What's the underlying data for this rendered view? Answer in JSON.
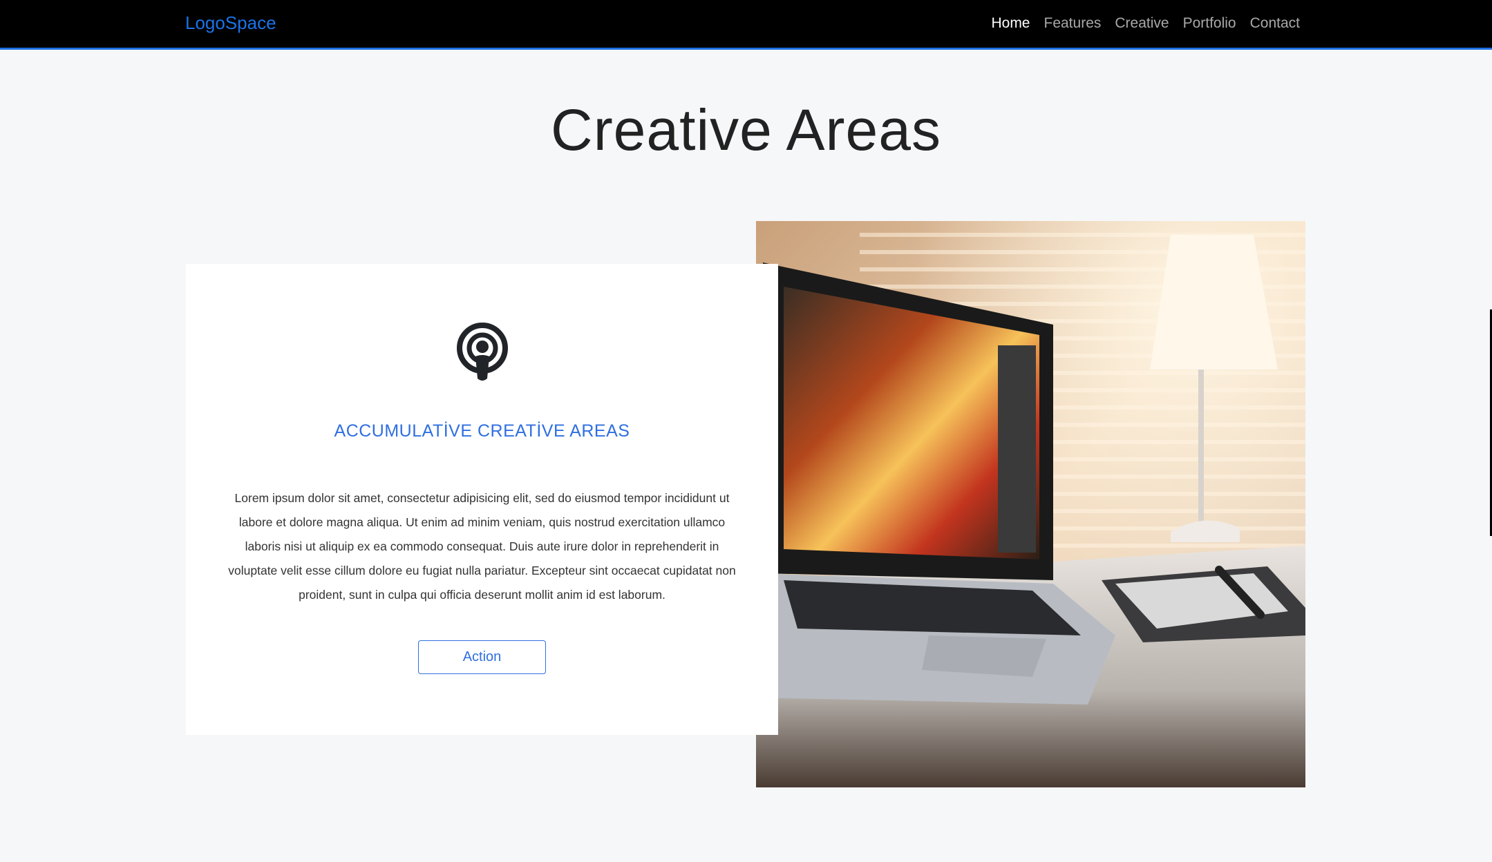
{
  "navbar": {
    "brand": "LogoSpace",
    "links": [
      {
        "label": "Home",
        "active": true
      },
      {
        "label": "Features",
        "active": false
      },
      {
        "label": "Creative",
        "active": false
      },
      {
        "label": "Portfolio",
        "active": false
      },
      {
        "label": "Contact",
        "active": false
      }
    ]
  },
  "section": {
    "title": "Creative Areas"
  },
  "card": {
    "icon": "podcast-icon",
    "heading": "ACCUMULATİVE CREATİVE AREAS",
    "text": "Lorem ipsum dolor sit amet, consectetur adipisicing elit, sed do eiusmod tempor incididunt ut labore et dolore magna aliqua. Ut enim ad minim veniam, quis nostrud exercitation ullamco laboris nisi ut aliquip ex ea commodo consequat. Duis aute irure dolor in reprehenderit in voluptate velit esse cillum dolore eu fugiat nulla pariatur. Excepteur sint occaecat cupidatat non proident, sunt in culpa qui officia deserunt mollit anim id est laborum.",
    "button_label": "Action"
  },
  "colors": {
    "accent": "#2f6fe0",
    "navbar_bg": "#000000",
    "page_bg": "#f6f7f9"
  }
}
